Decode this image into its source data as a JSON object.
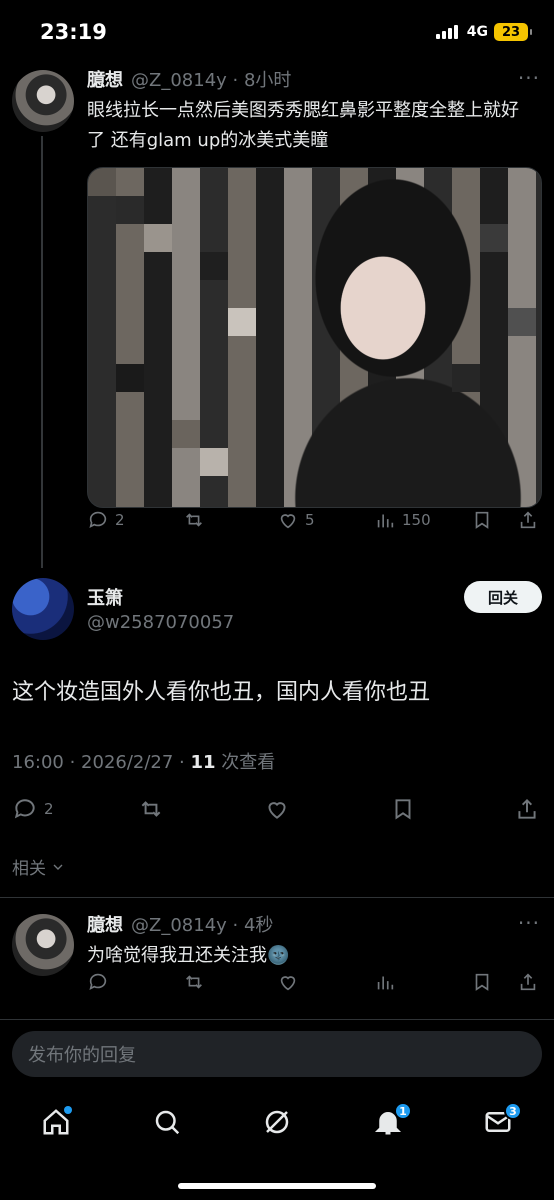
{
  "status_bar": {
    "time": "23:19",
    "network": "4G",
    "battery": "23"
  },
  "tweet1": {
    "name": "臆想",
    "handle": "@Z_0814y",
    "time": "8小时",
    "handle_time": "@Z_0814y · 8小时",
    "text": "眼线拉长一点然后美图秀秀腮红鼻影平整度全整上就好了 还有glam up的冰美式美瞳",
    "stats": {
      "replies": "2",
      "likes": "5",
      "views": "150"
    }
  },
  "tweet2": {
    "name": "玉箫",
    "handle": "@w2587070057",
    "follow_label": "回关",
    "text": "这个妆造国外人看你也丑，国内人看你也丑",
    "timestamp": "16:00 · 2026/2/27 · ",
    "views_count": "11",
    "views_label": " 次查看",
    "stats": {
      "replies": "2"
    }
  },
  "related_label": "相关",
  "tweet3": {
    "name": "臆想",
    "handle_time": "@Z_0814y · 4秒",
    "text": "为啥觉得我丑还关注我🌚"
  },
  "reply_placeholder": "发布你的回复",
  "nav": {
    "notifications_badge": "1",
    "messages_badge": "3"
  },
  "colors": {
    "accent": "#1d9bf0",
    "background": "#000000",
    "muted": "#71767b"
  }
}
